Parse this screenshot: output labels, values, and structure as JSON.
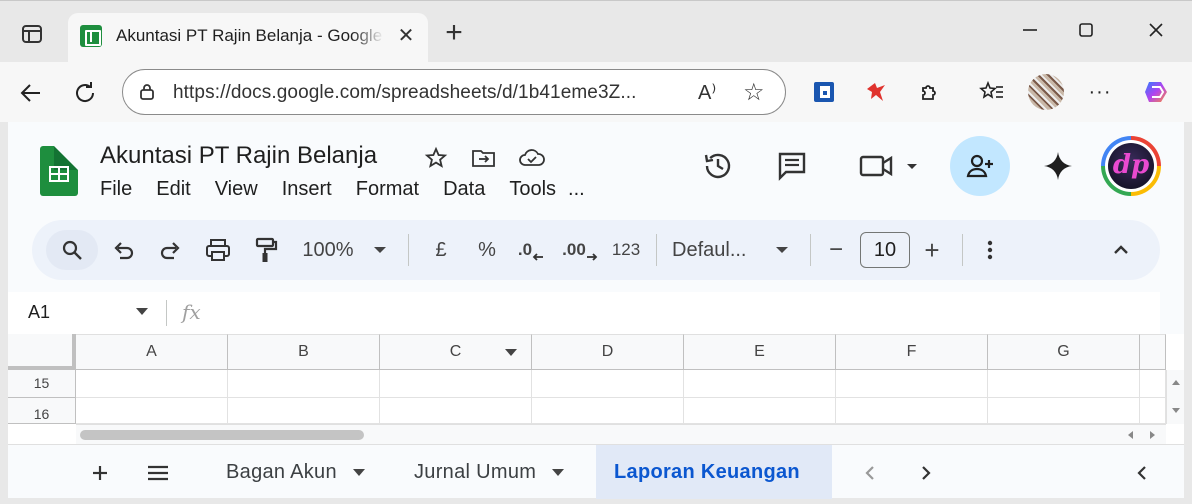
{
  "browser": {
    "tab_title": "Akuntasi PT Rajin Belanja - Google Sheets",
    "tab_close": "✕",
    "new_tab": "+",
    "window_controls": {
      "minimize": "—",
      "maximize": "☐",
      "close": "✕"
    },
    "url": "https://docs.google.com/spreadsheets/d/1b41eme3Z...",
    "read_aloud": "A⁾",
    "menu_dots": "···"
  },
  "doc": {
    "title": "Akuntasi PT Rajin Belanja",
    "menu": [
      "File",
      "Edit",
      "View",
      "Insert",
      "Format",
      "Data",
      "Tools",
      "..."
    ]
  },
  "toolbar": {
    "zoom": "100%",
    "currency": "£",
    "percent": "%",
    "decrease_decimal": ".0",
    "increase_decimal": ".00",
    "number_format": "123",
    "font": "Defaul...",
    "font_size": "10",
    "minus": "−",
    "plus": "+"
  },
  "formula_bar": {
    "name_box": "A1",
    "fx": "fx"
  },
  "grid": {
    "columns": [
      "A",
      "B",
      "C",
      "D",
      "E",
      "F",
      "G"
    ],
    "rows": [
      "15",
      "16"
    ]
  },
  "sheets": {
    "tabs": [
      {
        "label": "Bagan Akun",
        "active": false
      },
      {
        "label": "Jurnal Umum",
        "active": false
      },
      {
        "label": "Laporan Keuangan",
        "active": true
      }
    ]
  },
  "colors": {
    "accent": "#0b57d0",
    "sheets_green": "#1e8e3e",
    "share_bg": "#c2e7ff"
  }
}
